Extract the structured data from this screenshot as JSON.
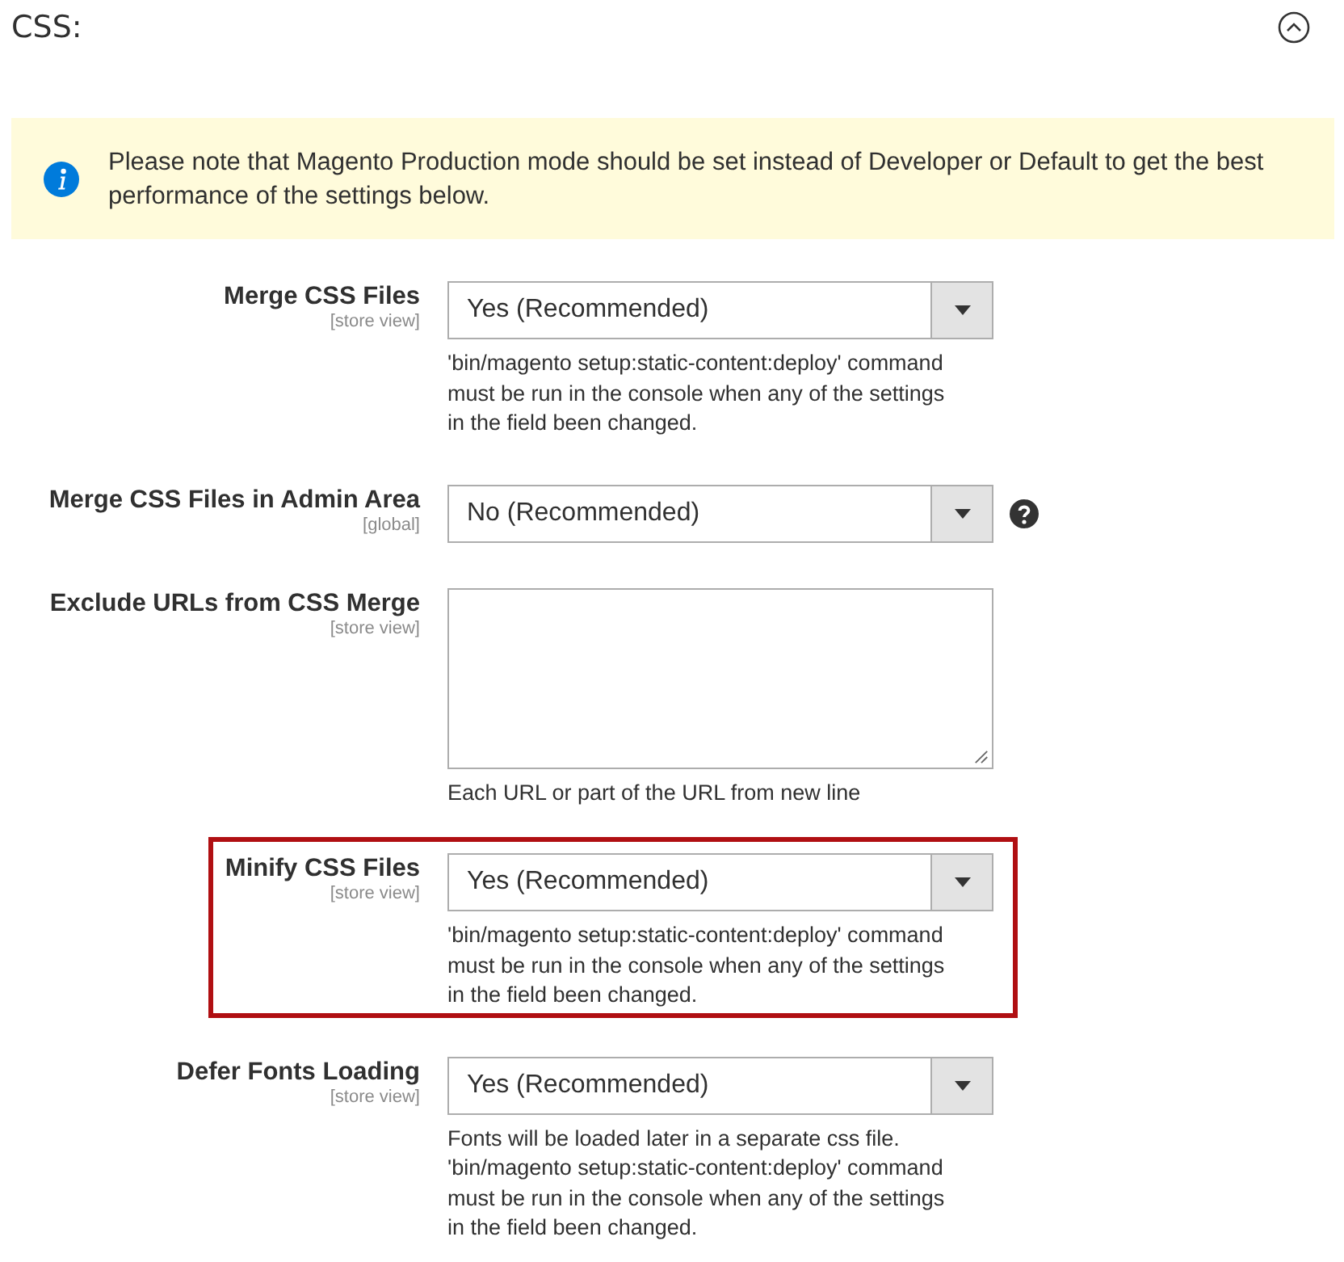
{
  "section": {
    "title": "CSS:",
    "expanded": true
  },
  "notice": {
    "text": "Please note that Magento Production mode should be set instead of Developer or Default to get the best performance of the settings below."
  },
  "fields": [
    {
      "kind": "select",
      "label": "Merge CSS Files",
      "scope": "[store view]",
      "value": "Yes (Recommended)",
      "help": false,
      "highlighted": false,
      "note": [
        "'bin/magento setup:static-content:deploy' command",
        "must be run in the console when any of the settings",
        "in the field been changed."
      ]
    },
    {
      "kind": "select",
      "label": "Merge CSS Files in Admin Area",
      "scope": "[global]",
      "value": "No (Recommended)",
      "help": true,
      "highlighted": false
    },
    {
      "kind": "textarea",
      "label": "Exclude URLs from CSS Merge",
      "scope": "[store view]",
      "help": false,
      "highlighted": false,
      "note": [
        "Each URL or part of the URL from new line"
      ]
    },
    {
      "kind": "select",
      "label": "Minify CSS Files",
      "scope": "[store view]",
      "value": "Yes (Recommended)",
      "help": false,
      "highlighted": true,
      "note": [
        "'bin/magento setup:static-content:deploy' command",
        "must be run in the console when any of the settings",
        "in the field been changed."
      ]
    },
    {
      "kind": "select",
      "label": "Defer Fonts Loading",
      "scope": "[store view]",
      "value": "Yes (Recommended)",
      "help": false,
      "highlighted": false,
      "note": [
        "Fonts will be loaded later in a separate css file.",
        "'bin/magento setup:static-content:deploy' command",
        "must be run in the console when any of the settings",
        "in the field been changed."
      ]
    }
  ]
}
